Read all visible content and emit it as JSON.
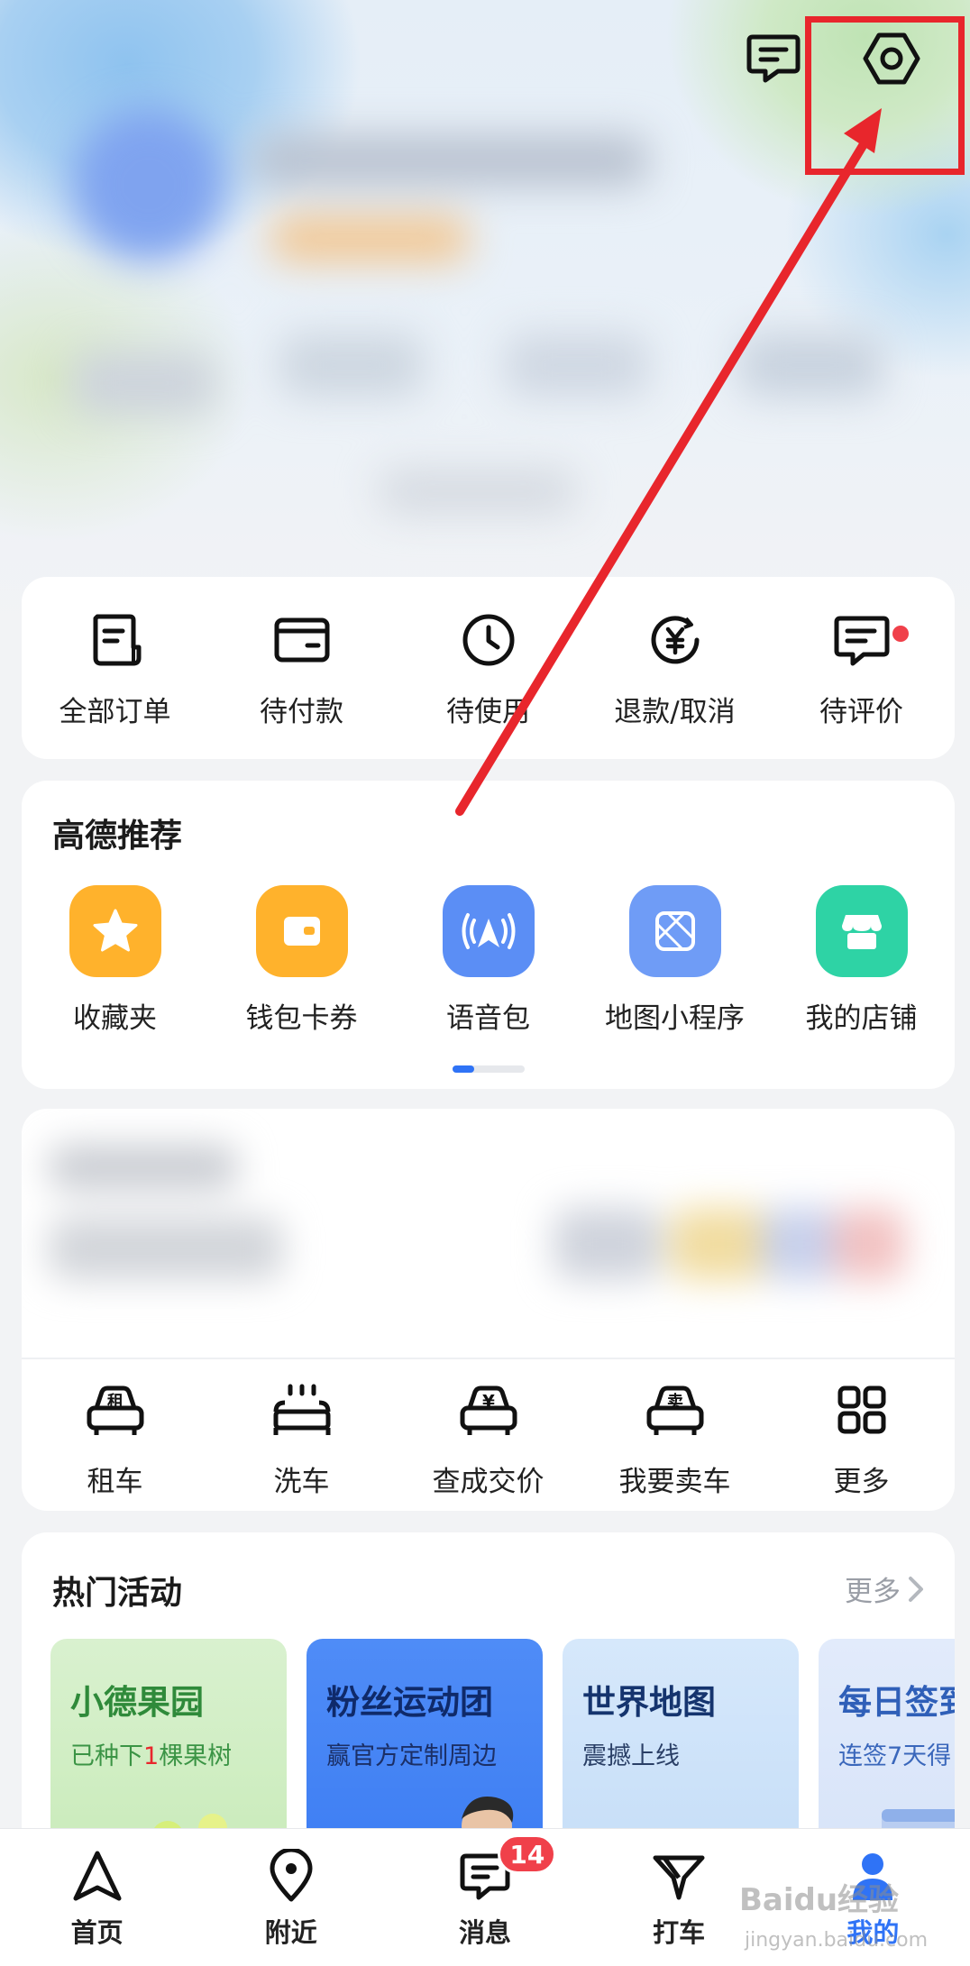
{
  "header": {
    "message_icon": "message-icon",
    "settings_icon": "settings-hexagon-icon",
    "annotation_color": "#e8262c"
  },
  "orders": {
    "items": [
      {
        "label": "全部订单",
        "icon": "order-list-icon"
      },
      {
        "label": "待付款",
        "icon": "wallet-card-icon"
      },
      {
        "label": "待使用",
        "icon": "clock-icon"
      },
      {
        "label": "退款/取消",
        "icon": "yuan-refund-icon"
      },
      {
        "label": "待评价",
        "icon": "comment-icon",
        "has_dot": true
      }
    ]
  },
  "recommend": {
    "title": "高德推荐",
    "items": [
      {
        "label": "收藏夹",
        "icon": "star-icon",
        "color": "#ffb22c"
      },
      {
        "label": "钱包卡券",
        "icon": "wallet-icon",
        "color": "#ffb22c"
      },
      {
        "label": "语音包",
        "icon": "voice-nav-icon",
        "color": "#5b8ef5"
      },
      {
        "label": "地图小程序",
        "icon": "mini-program-icon",
        "color": "#6f9cf6"
      },
      {
        "label": "我的店铺",
        "icon": "shop-icon",
        "color": "#2ed3a5"
      }
    ]
  },
  "car_services": {
    "items": [
      {
        "label": "租车",
        "icon": "rent-car-icon",
        "glyph": "租"
      },
      {
        "label": "洗车",
        "icon": "car-wash-icon"
      },
      {
        "label": "查成交价",
        "icon": "car-price-icon",
        "glyph": "¥"
      },
      {
        "label": "我要卖车",
        "icon": "sell-car-icon",
        "glyph": "卖"
      },
      {
        "label": "更多",
        "icon": "grid-more-icon"
      }
    ]
  },
  "hot": {
    "title": "热门活动",
    "more_label": "更多",
    "banners": [
      {
        "title": "小德果园",
        "subtitle_pre": "已种下",
        "subtitle_hl": "1",
        "subtitle_post": "棵果树"
      },
      {
        "title": "粉丝运动团",
        "subtitle": "赢官方定制周边"
      },
      {
        "title": "世界地图",
        "subtitle": "震撼上线"
      },
      {
        "title": "每日签到",
        "subtitle": "连签7天得"
      }
    ]
  },
  "bottom_nav": {
    "items": [
      {
        "label": "首页",
        "icon": "navigation-arrow-icon"
      },
      {
        "label": "附近",
        "icon": "location-pin-icon"
      },
      {
        "label": "消息",
        "icon": "message-icon",
        "badge": "14"
      },
      {
        "label": "打车",
        "icon": "taxi-icon"
      },
      {
        "label": "我的",
        "icon": "user-icon",
        "active": true
      }
    ]
  },
  "watermark": {
    "text": "Baidu经验",
    "sub": "jingyan.baidu.com"
  }
}
